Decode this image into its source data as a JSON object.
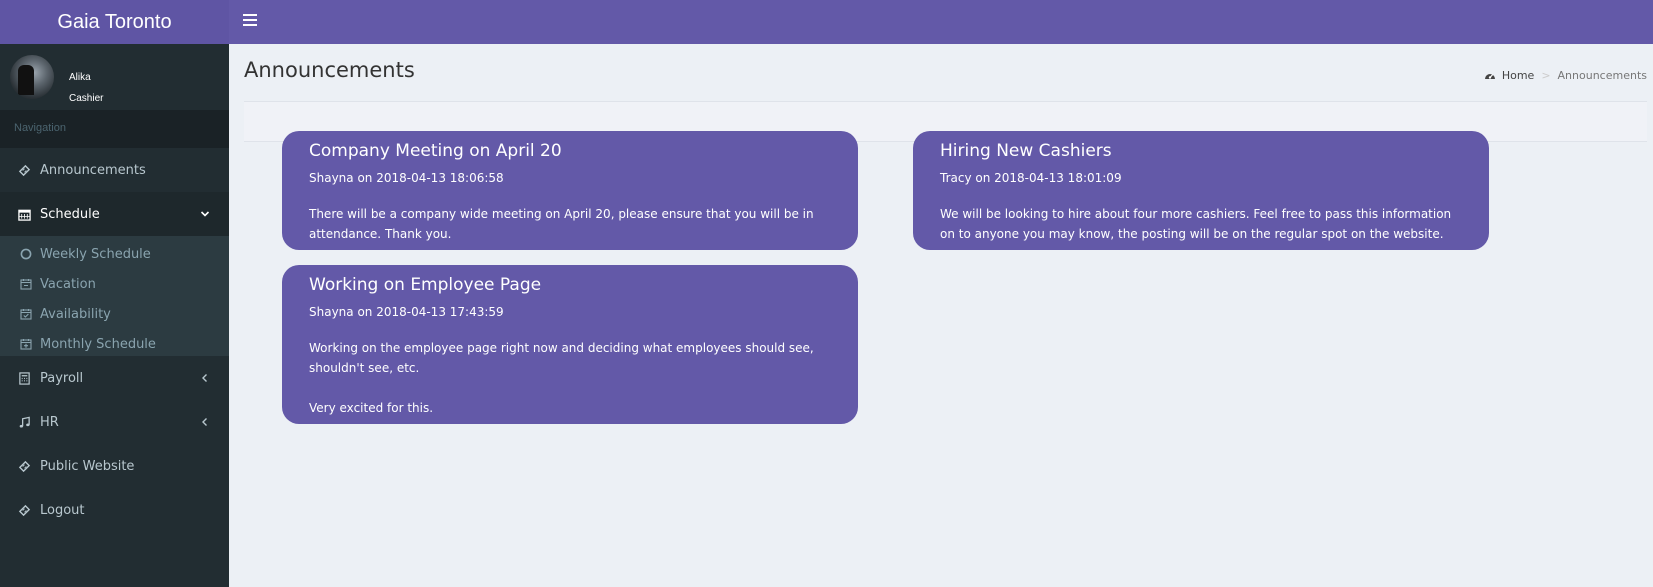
{
  "brand": "Gaia Toronto",
  "user": {
    "name": "Alika",
    "role": "Cashier"
  },
  "sidebar": {
    "header": "Navigation",
    "items": [
      {
        "label": "Announcements",
        "icon": "ticket-icon"
      },
      {
        "label": "Schedule",
        "icon": "calendar-icon"
      },
      {
        "label": "Payroll",
        "icon": "calculator-icon"
      },
      {
        "label": "HR",
        "icon": "music-icon"
      },
      {
        "label": "Public Website",
        "icon": "ticket-icon"
      },
      {
        "label": "Logout",
        "icon": "ticket-icon"
      }
    ],
    "schedule_submenu": [
      {
        "label": "Weekly Schedule",
        "icon": "circle-icon"
      },
      {
        "label": "Vacation",
        "icon": "calendar-minus-icon"
      },
      {
        "label": "Availability",
        "icon": "calendar-check-icon"
      },
      {
        "label": "Monthly Schedule",
        "icon": "calendar-plus-icon"
      }
    ]
  },
  "page": {
    "title": "Announcements",
    "breadcrumb": {
      "home": "Home",
      "separator": ">",
      "current": "Announcements"
    }
  },
  "announcements": [
    {
      "title": "Company Meeting on April 20",
      "meta": "Shayna on 2018-04-13 18:06:58",
      "body": "There will be a company wide meeting on April 20, please ensure that you will be in attendance. Thank you."
    },
    {
      "title": "Hiring New Cashiers",
      "meta": "Tracy on 2018-04-13 18:01:09",
      "body": "We will be looking to hire about four more cashiers. Feel free to pass this information on to anyone you may know, the posting will be on the regular spot on the website."
    },
    {
      "title": "Working on Employee Page",
      "meta": "Shayna on 2018-04-13 17:43:59",
      "body": "Working on the employee page right now and deciding what employees should see, shouldn't see, etc.\n\nVery excited for this."
    }
  ],
  "colors": {
    "header": "#6359a8",
    "logo_bg": "#5f55a4",
    "sidebar_bg": "#222d32",
    "card_bg": "#6359a8",
    "content_bg": "#ecf0f5"
  }
}
